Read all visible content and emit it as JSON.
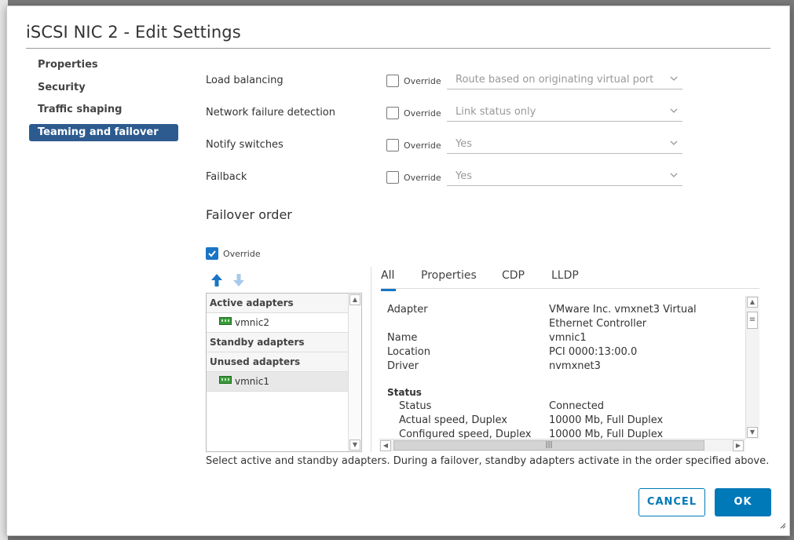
{
  "dialog": {
    "title": "iSCSI NIC 2 - Edit Settings"
  },
  "nav": {
    "items": [
      {
        "label": "Properties"
      },
      {
        "label": "Security"
      },
      {
        "label": "Traffic shaping"
      },
      {
        "label": "Teaming and failover"
      }
    ],
    "active_index": 3
  },
  "settings": {
    "override_label": "Override",
    "rows": [
      {
        "label": "Load balancing",
        "override": false,
        "value": "Route based on originating virtual port"
      },
      {
        "label": "Network failure detection",
        "override": false,
        "value": "Link status only"
      },
      {
        "label": "Notify switches",
        "override": false,
        "value": "Yes"
      },
      {
        "label": "Failback",
        "override": false,
        "value": "Yes"
      }
    ]
  },
  "failover": {
    "title": "Failover order",
    "override_label": "Override",
    "override": true,
    "groups": [
      {
        "label": "Active adapters",
        "adapters": [
          "vmnic2"
        ]
      },
      {
        "label": "Standby adapters",
        "adapters": []
      },
      {
        "label": "Unused adapters",
        "adapters": [
          "vmnic1"
        ]
      }
    ],
    "selected_adapter": "vmnic1"
  },
  "details": {
    "tabs": [
      "All",
      "Properties",
      "CDP",
      "LLDP"
    ],
    "active_tab": "All",
    "fields": {
      "adapter_key": "Adapter",
      "adapter_val": "VMware Inc. vmxnet3 Virtual Ethernet Controller",
      "name_key": "Name",
      "name_val": "vmnic1",
      "location_key": "Location",
      "location_val": "PCI 0000:13:00.0",
      "driver_key": "Driver",
      "driver_val": "nvmxnet3"
    },
    "status": {
      "title": "Status",
      "status_key": "Status",
      "status_val": "Connected",
      "actual_key": "Actual speed, Duplex",
      "actual_val": "10000 Mb, Full Duplex",
      "configured_key": "Configured speed, Duplex",
      "configured_val": "10000 Mb, Full Duplex"
    }
  },
  "footer": {
    "hint": "Select active and standby adapters. During a failover, standby adapters activate in the order specified above.",
    "cancel_label": "CANCEL",
    "ok_label": "OK"
  },
  "colors": {
    "accent": "#0079b8",
    "nav_active": "#2d5b8f",
    "checkbox": "#1a75c5"
  }
}
